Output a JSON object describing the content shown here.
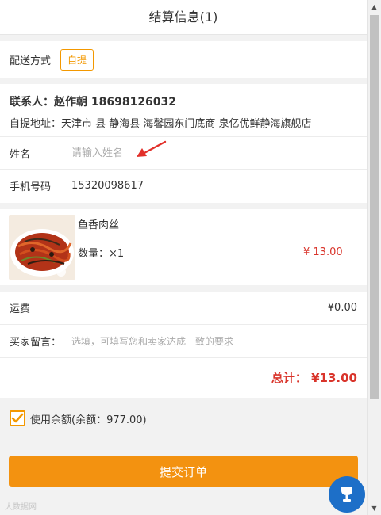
{
  "header": {
    "title": "结算信息(1)"
  },
  "delivery": {
    "label": "配送方式",
    "option": "自提"
  },
  "contact": {
    "line": "联系人：赵作朝 18698126032",
    "pickup_label": "自提地址：",
    "pickup_address": "天津市 县 静海县 海馨园东门底商 泉亿优鲜静海旗舰店"
  },
  "name_field": {
    "label": "姓名",
    "placeholder": "请输入姓名"
  },
  "phone_field": {
    "label": "手机号码",
    "value": "15320098617"
  },
  "product": {
    "name": "鱼香肉丝",
    "qty_label": "数量：×1",
    "price": "¥ 13.00"
  },
  "shipping": {
    "label": "运费",
    "value": "¥0.00"
  },
  "message": {
    "label": "买家留言：",
    "placeholder": "选填，可填写您和卖家达成一致的要求"
  },
  "total": {
    "text": "总计： ¥13.00"
  },
  "balance": {
    "checked": true,
    "label": "使用余额(余额：977.00)"
  },
  "submit": {
    "label": "提交订单"
  },
  "watermark": {
    "text": "大数据网"
  },
  "colors": {
    "accent": "#f39800",
    "price": "#d9342b",
    "float_button": "#1d6fc8"
  }
}
